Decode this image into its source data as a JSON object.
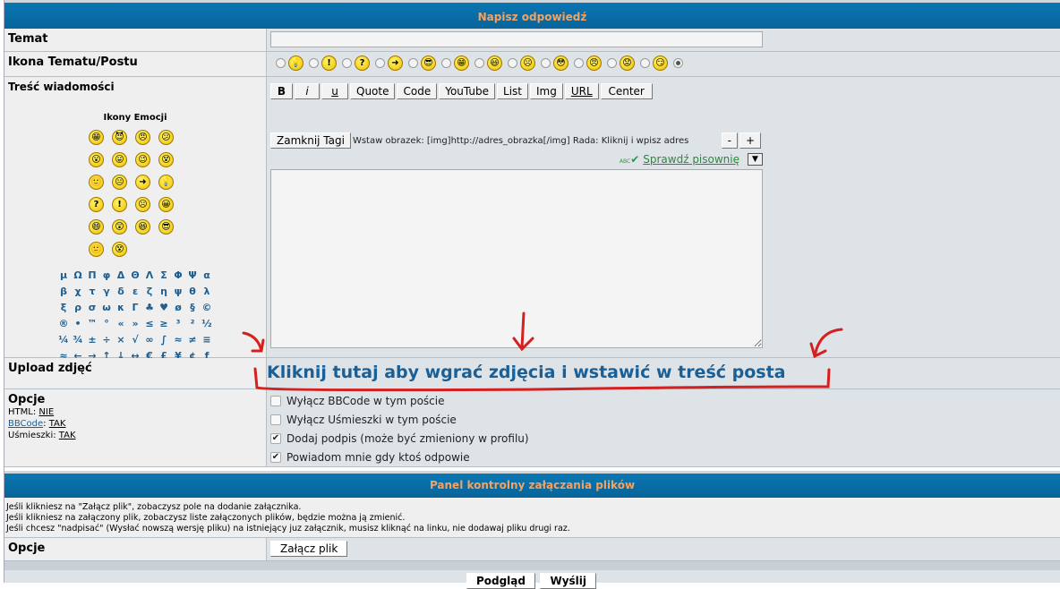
{
  "header": {
    "title": "Napisz odpowiedź"
  },
  "subject": {
    "label": "Temat",
    "value": ""
  },
  "post_icon": {
    "label": "Ikona Tematu/Postu",
    "icons": [
      "💡",
      "!",
      "?",
      "➜",
      "😎",
      "😁",
      "😃",
      "☹",
      "😳",
      "😠",
      "😟",
      "😏"
    ]
  },
  "message": {
    "label": "Treść wiadomości",
    "toolbar": [
      "B",
      "i",
      "u",
      "Quote",
      "Code",
      "YouTube",
      "List",
      "Img",
      "URL",
      "Center"
    ],
    "close_tags": "Zamknij Tagi",
    "hint": "Wstaw obrazek: [img]http://adres_obrazka[/img] Rada: Kliknij i wpisz adres",
    "minus": "-",
    "plus": "+",
    "spellcheck": "Sprawdź pisownię",
    "spell_icon_text": "ABC",
    "emoticons_title": "Ikony Emocji",
    "emoticons": [
      "😁",
      "😈",
      "😠",
      "😕",
      "😮",
      "😛",
      "😉",
      "😵",
      "🙂",
      "😐",
      "➜",
      "💡",
      "?",
      "!",
      "☹",
      "😀",
      "😄",
      "😲",
      "😆",
      "😎",
      "🙂",
      "😵"
    ],
    "symbols": [
      "μ",
      "Ω",
      "Π",
      "φ",
      "Δ",
      "Θ",
      "Λ",
      "Σ",
      "Φ",
      "Ψ",
      "α",
      "β",
      "χ",
      "τ",
      "γ",
      "δ",
      "ε",
      "ζ",
      "η",
      "ψ",
      "θ",
      "λ",
      "ξ",
      "ρ",
      "σ",
      "ω",
      "κ",
      "Γ",
      "♣",
      "♥",
      "ø",
      "§",
      "©",
      "®",
      "•",
      "™",
      "°",
      "«",
      "»",
      "≤",
      "≥",
      "³",
      "²",
      "½",
      "¼",
      "¾",
      "±",
      "÷",
      "×",
      "√",
      "∞",
      "∫",
      "≈",
      "≠",
      "≡",
      "≈",
      "←",
      "→",
      "↑",
      "↓",
      "↔",
      "€",
      "£",
      "¥",
      "¢",
      "ƒ"
    ]
  },
  "upload": {
    "label": "Upload zdjęć",
    "link": "Kliknij tutaj aby wgrać zdjęcia i wstawić w treść posta"
  },
  "options": {
    "label": "Opcje",
    "html_label": "HTML:",
    "html_value": "NIE",
    "bbcode_label": "BBCode",
    "bbcode_value": "TAK",
    "smilies_label": "Uśmieszki:",
    "smilies_value": "TAK",
    "checkboxes": [
      {
        "label": "Wyłącz BBCode w tym poście",
        "checked": false
      },
      {
        "label": "Wyłącz Uśmieszki w tym poście",
        "checked": false
      },
      {
        "label": "Dodaj podpis (może być zmieniony w profilu)",
        "checked": true
      },
      {
        "label": "Powiadom mnie gdy ktoś odpowie",
        "checked": true
      }
    ]
  },
  "attach": {
    "title": "Panel kontrolny załączania plików",
    "info": [
      "Jeśli klikniesz na \"Załącz plik\", zobaczysz pole na dodanie załącznika.",
      "Jeśli klikniesz na załączony plik, zobaczysz liste załączonych plików, będzie można ją zmienić.",
      "Jeśli chcesz \"nadpisać\" (Wysłać nowszą wersję pliku) na istniejący juz załącznik, musisz kliknąć na linku, nie dodawaj pliku drugi raz."
    ],
    "options_label": "Opcje",
    "attach_button": "Załącz plik"
  },
  "footer": {
    "preview": "Podgląd",
    "send": "Wyślij"
  },
  "colors": {
    "header_bg": "#0a6fa8",
    "header_text": "#f4a261",
    "annotation": "#d42020",
    "upload_link": "#1a5f96"
  }
}
